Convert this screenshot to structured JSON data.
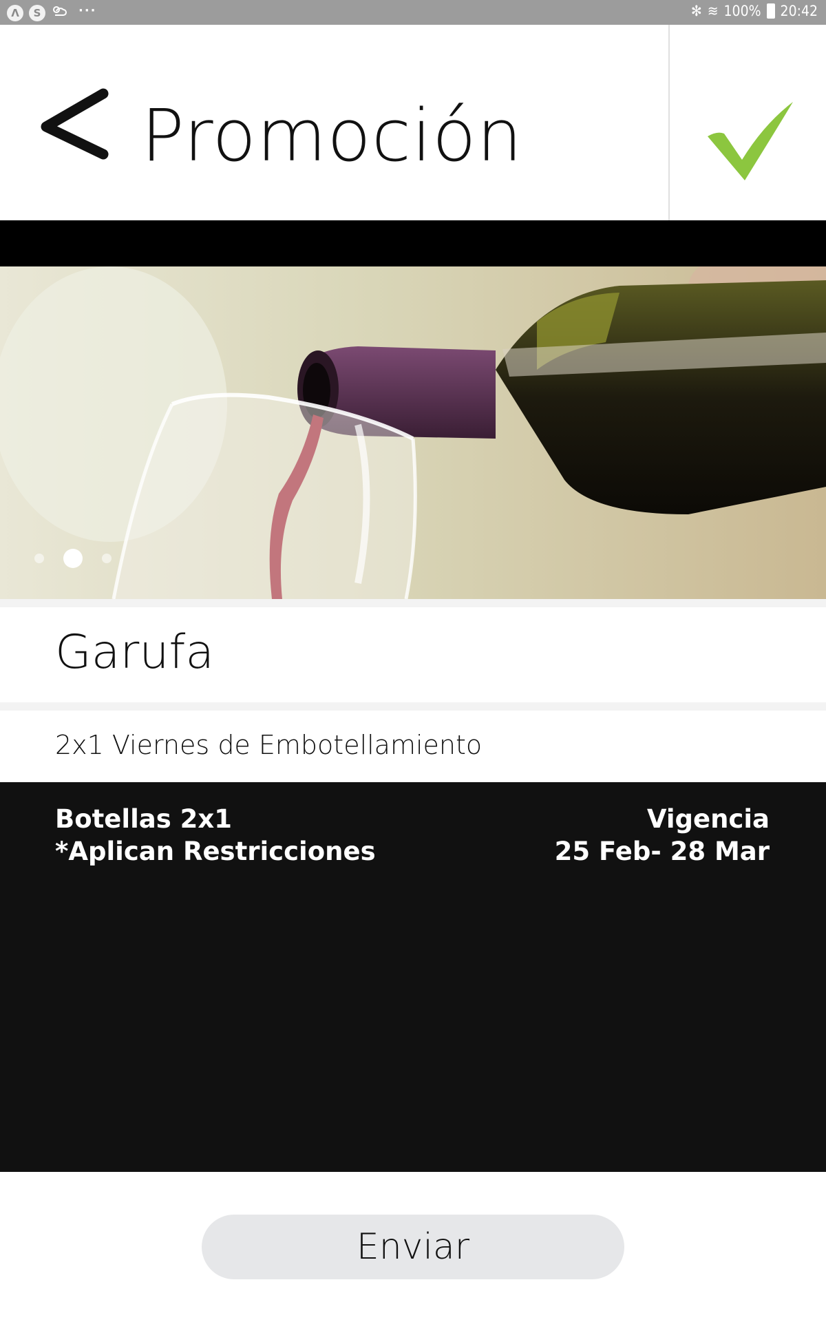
{
  "status_bar": {
    "left_icons": [
      "accessibility-icon",
      "skype-icon",
      "weather-icon"
    ],
    "left_badge_a": "Λ",
    "left_badge_s": "S",
    "overflow": "···",
    "bluetooth": "✻",
    "wifi": "≋",
    "battery": "100%",
    "time": "20:42"
  },
  "header": {
    "title": "Promoción",
    "back_icon": "chevron-left-icon",
    "confirm_icon": "checkmark-icon",
    "confirm_color": "#8cc63f"
  },
  "carousel": {
    "image": "wine-pouring-photo",
    "page_count": 3,
    "active_page": 2
  },
  "promo": {
    "venue": "Garufa",
    "subtitle": "2x1 Viernes de Embotellamiento",
    "details_line1": "Botellas 2x1",
    "details_line2": "*Aplican Restricciones",
    "validity_label": "Vigencia",
    "validity_dates": "25 Feb- 28 Mar"
  },
  "actions": {
    "send_label": "Enviar"
  }
}
